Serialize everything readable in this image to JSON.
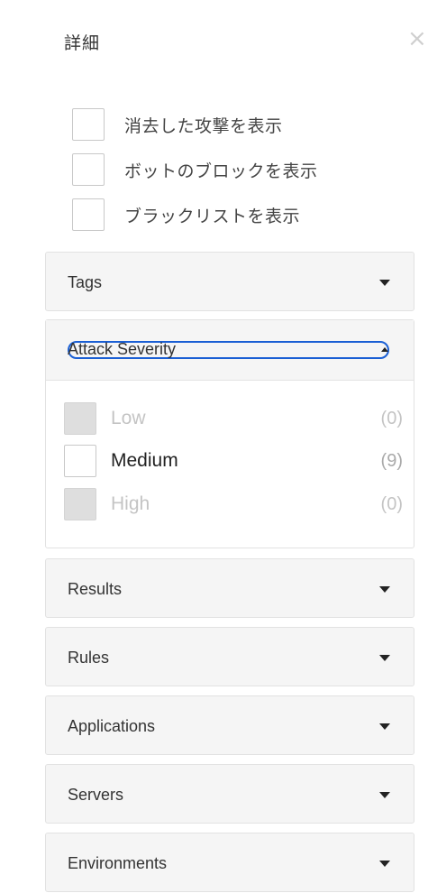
{
  "panel": {
    "title": "詳細",
    "close_glyph": "×"
  },
  "toggles": [
    {
      "label": "消去した攻撃を表示",
      "checked": false
    },
    {
      "label": "ボットのブロックを表示",
      "checked": false
    },
    {
      "label": "ブラックリストを表示",
      "checked": false
    }
  ],
  "filters": {
    "tags": {
      "label": "Tags"
    },
    "attack_severity": {
      "label": "Attack Severity",
      "expanded": true,
      "options": [
        {
          "label": "Low",
          "count": "(0)",
          "enabled": false
        },
        {
          "label": "Medium",
          "count": "(9)",
          "enabled": true
        },
        {
          "label": "High",
          "count": "(0)",
          "enabled": false
        }
      ]
    },
    "results": {
      "label": "Results"
    },
    "rules": {
      "label": "Rules"
    },
    "applications": {
      "label": "Applications"
    },
    "servers": {
      "label": "Servers"
    },
    "environments": {
      "label": "Environments"
    }
  },
  "colors": {
    "focus_ring": "#1a5fd4",
    "section_bg": "#f5f5f5",
    "disabled_checkbox": "#dedede"
  }
}
